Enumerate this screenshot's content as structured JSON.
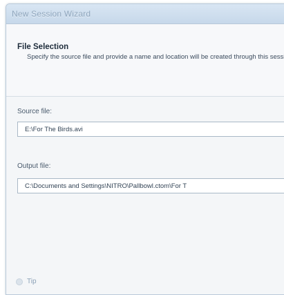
{
  "window": {
    "title": "New Session Wizard"
  },
  "header": {
    "step_title": "File Selection",
    "description": "Specify the source file and provide a name and location will be created through this session."
  },
  "fields": {
    "source_label": "Source file:",
    "source_value": "E:\\For The Birds.avi",
    "output_label": "Output file:",
    "output_value": "C:\\Documents and Settings\\NITRO\\Pallbowl.ctom\\For T"
  },
  "footer": {
    "tip_label": "Tip"
  },
  "icons": {
    "tip": "tip-icon"
  }
}
